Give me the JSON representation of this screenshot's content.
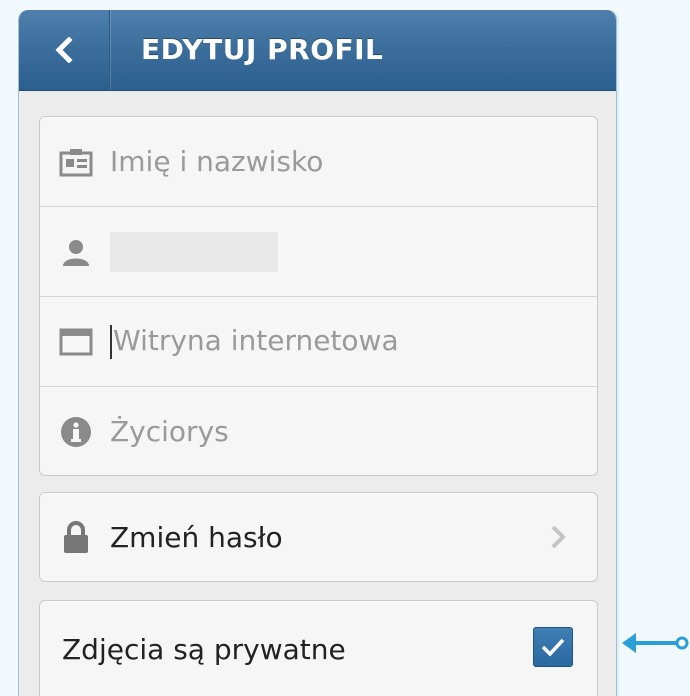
{
  "header": {
    "title": "EDYTUJ PROFIL",
    "back_icon": "chevron-left-icon"
  },
  "fields": [
    {
      "icon": "id-card-icon",
      "placeholder": "Imię i nazwisko",
      "value": ""
    },
    {
      "icon": "user-icon",
      "placeholder": "",
      "value": ""
    },
    {
      "icon": "browser-window-icon",
      "placeholder": "Witryna internetowa",
      "value": "",
      "focused": true
    },
    {
      "icon": "info-icon",
      "placeholder": "Życiorys",
      "value": ""
    }
  ],
  "password": {
    "label": "Zmień hasło",
    "icon": "lock-icon"
  },
  "privacy": {
    "label": "Zdjęcia są prywatne",
    "checked": true
  },
  "colors": {
    "header_top": "#4f80ad",
    "header_bottom": "#2b5f8d",
    "accent": "#2a9fd6",
    "checkbox": "#2a68a0"
  }
}
